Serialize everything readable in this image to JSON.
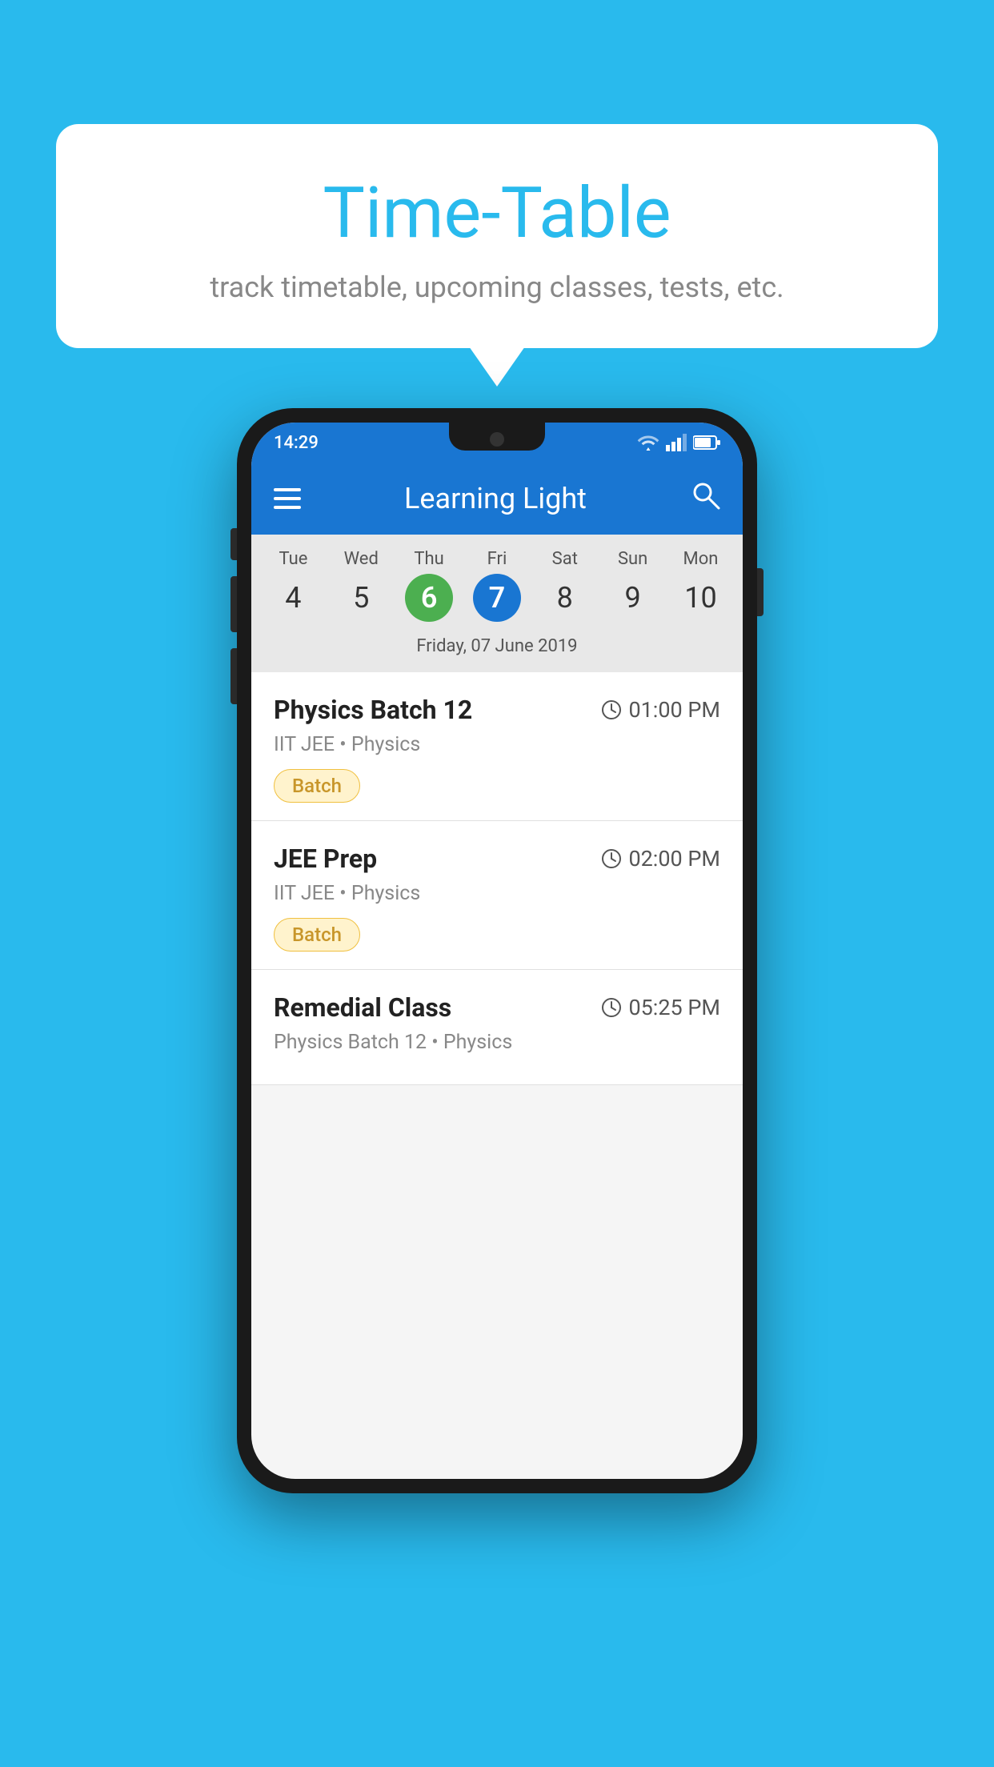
{
  "background_color": "#29BAED",
  "bubble": {
    "title": "Time-Table",
    "subtitle": "track timetable, upcoming classes, tests, etc."
  },
  "phone": {
    "status_bar": {
      "time": "14:29"
    },
    "app_bar": {
      "title": "Learning Light"
    },
    "calendar": {
      "days": [
        {
          "name": "Tue",
          "num": "4",
          "state": "normal"
        },
        {
          "name": "Wed",
          "num": "5",
          "state": "normal"
        },
        {
          "name": "Thu",
          "num": "6",
          "state": "today"
        },
        {
          "name": "Fri",
          "num": "7",
          "state": "selected"
        },
        {
          "name": "Sat",
          "num": "8",
          "state": "normal"
        },
        {
          "name": "Sun",
          "num": "9",
          "state": "normal"
        },
        {
          "name": "Mon",
          "num": "10",
          "state": "normal"
        }
      ],
      "selected_date_label": "Friday, 07 June 2019"
    },
    "schedule": [
      {
        "title": "Physics Batch 12",
        "time": "01:00 PM",
        "subtitle": "IIT JEE • Physics",
        "badge": "Batch"
      },
      {
        "title": "JEE Prep",
        "time": "02:00 PM",
        "subtitle": "IIT JEE • Physics",
        "badge": "Batch"
      },
      {
        "title": "Remedial Class",
        "time": "05:25 PM",
        "subtitle": "Physics Batch 12 • Physics",
        "badge": null
      }
    ]
  }
}
